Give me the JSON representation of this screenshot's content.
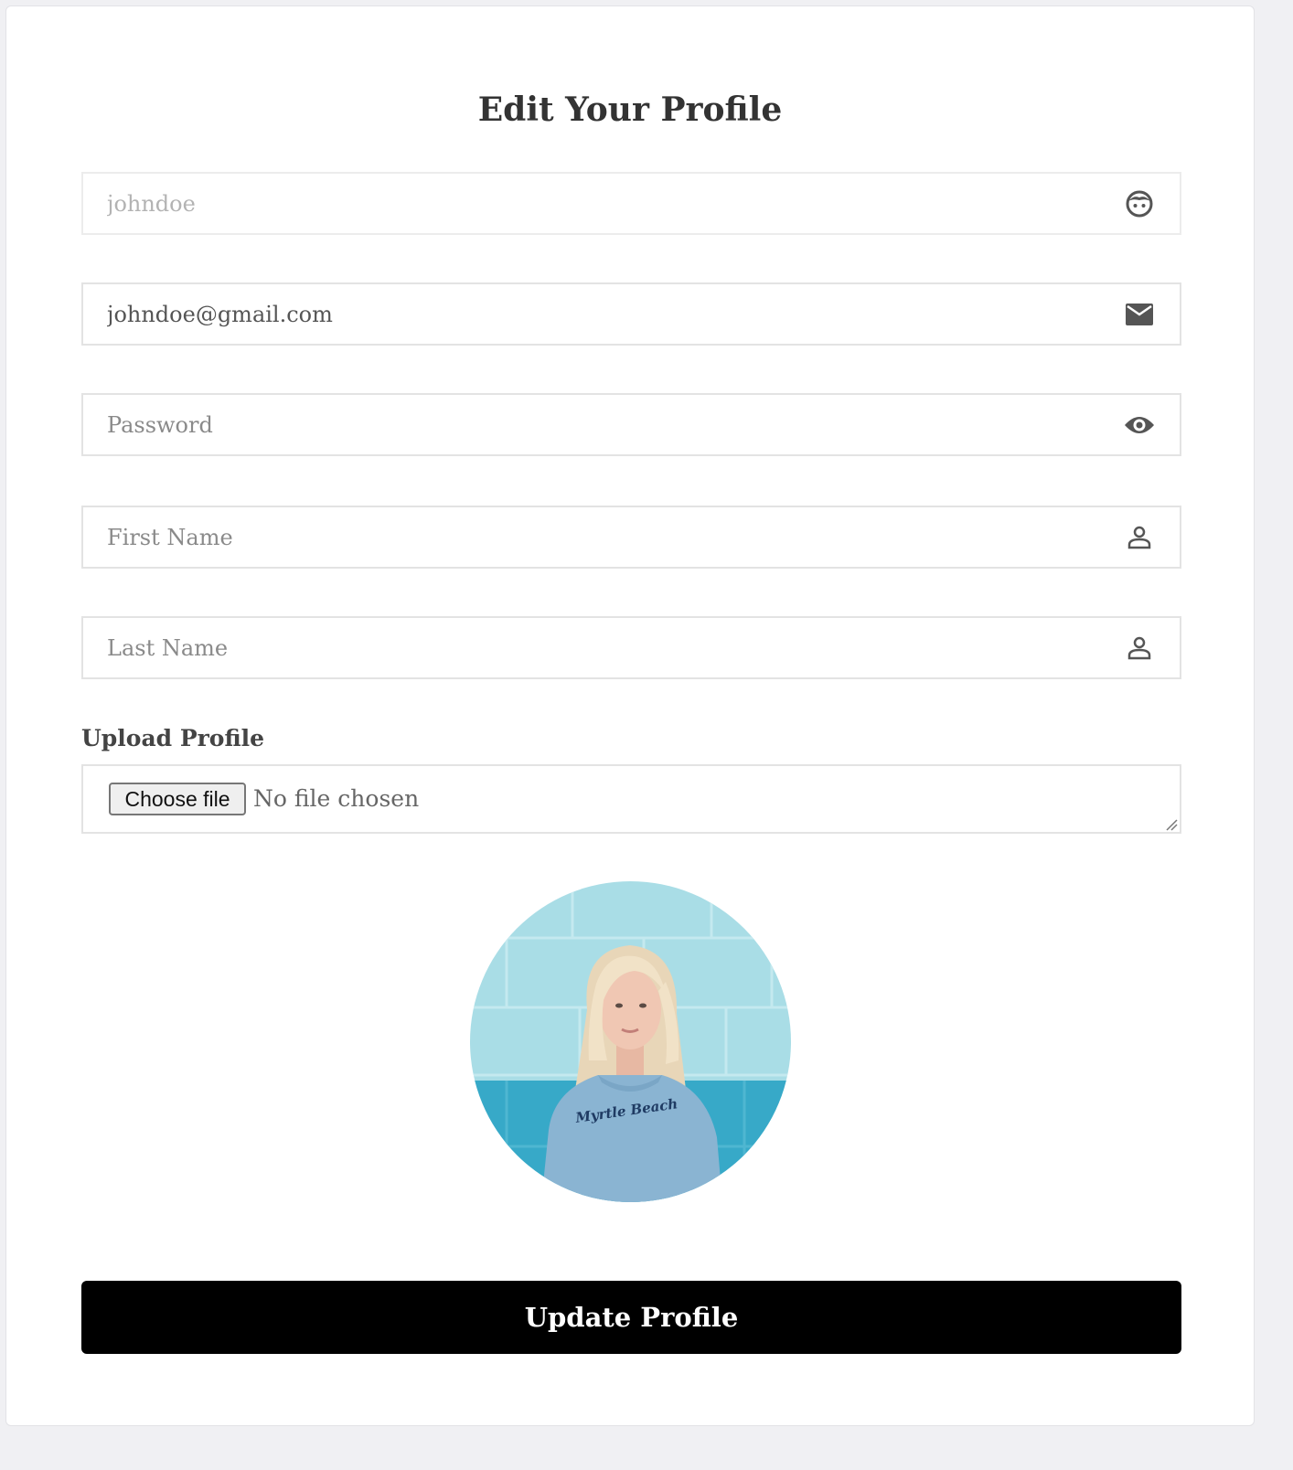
{
  "form": {
    "title": "Edit Your Profile",
    "username": {
      "value": "johndoe",
      "icon": "face-icon"
    },
    "email": {
      "value": "johndoe@gmail.com",
      "icon": "envelope-icon"
    },
    "password": {
      "placeholder": "Password",
      "icon": "eye-icon"
    },
    "first_name": {
      "placeholder": "First Name",
      "icon": "person-icon"
    },
    "last_name": {
      "placeholder": "Last Name",
      "icon": "person-icon"
    },
    "upload": {
      "label": "Upload Profile",
      "button_label": "Choose file",
      "status": "No file chosen"
    },
    "avatar": {
      "shirt_text": "Myrtle Beach"
    },
    "submit_label": "Update Profile"
  },
  "colors": {
    "button_bg": "#000000",
    "button_text": "#ffffff",
    "title_text": "#333333",
    "field_border": "#e3e3e3",
    "icon_color": "#555555"
  }
}
